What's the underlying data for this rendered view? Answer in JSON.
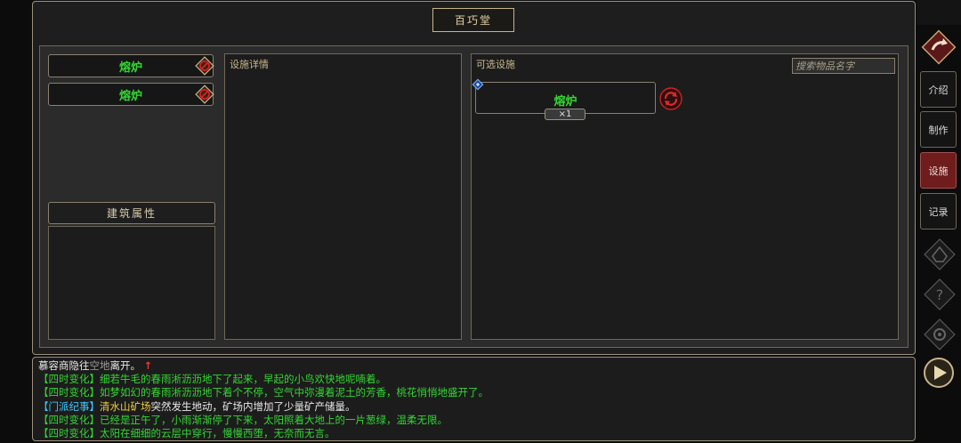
{
  "title": "百巧堂",
  "facility_list": [
    {
      "name": "熔炉"
    },
    {
      "name": "熔炉"
    }
  ],
  "building_attributes_label": "建筑属性",
  "detail_panel": {
    "label": "设施详情"
  },
  "available_panel": {
    "label": "可选设施",
    "search_placeholder": "搜索物品名字",
    "items": [
      {
        "name": "熔炉",
        "quantity": "×1"
      }
    ]
  },
  "sidebar": {
    "tabs": [
      {
        "label": "介绍"
      },
      {
        "label": "制作"
      },
      {
        "label": "设施"
      },
      {
        "label": "记录"
      }
    ],
    "active_tab": "设施"
  },
  "log": {
    "line1": {
      "a": "慕容商隐往",
      "b": "空地",
      "c": "离开。",
      "arrow": "↑"
    },
    "line2": {
      "tag": "【四时变化】",
      "text": "细若牛毛的春雨淅沥沥地下了起来，早起的小鸟欢快地呢喃着。"
    },
    "line3": {
      "tag": "【四时变化】",
      "text": "如梦如幻的春雨淅沥沥地下着个不停，空气中弥漫着泥土的芳香，桃花悄悄地盛开了。"
    },
    "line4": {
      "tag": "【门派纪事】",
      "place": "清水山矿场",
      "text": "突然发生地动，矿场内增加了少量矿产储量。"
    },
    "line5": {
      "tag": "【四时变化】",
      "text": "已经是正午了，小雨渐渐停了下来，太阳照着大地上的一片葱绿，温柔无限。"
    },
    "line6": {
      "tag": "【四时变化】",
      "text": "太阳在细细的云层中穿行，慢慢西堕，无奈而无言。"
    }
  },
  "colors": {
    "accent_green": "#33d633",
    "active_tab": "#6e1c1c",
    "highlight_cyan": "#39c8ff",
    "highlight_yellow": "#f0d040",
    "alert_red": "#ff3030"
  }
}
